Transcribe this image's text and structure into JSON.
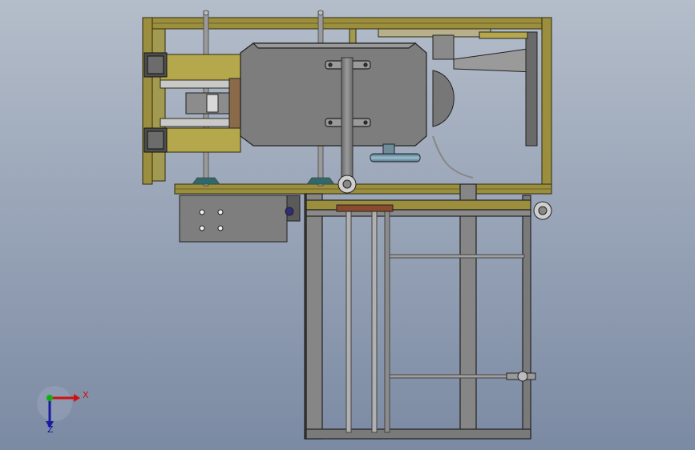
{
  "colors": {
    "background_top": "#b3bcc9",
    "background_bottom": "#7c8ba4",
    "frame_yellow": "#9b8f3e",
    "frame_edge": "#2e2a10",
    "metal_grey": "#878787",
    "metal_dark": "#5c5c5c",
    "motor_grey": "#707070",
    "panel_grey": "#828282",
    "cylinder_blue": "#6d8d9e",
    "brown_part": "#8b6a4a",
    "axis_x_red": "#d01010",
    "axis_y_blue": "#1a1aa0",
    "triad_green": "#10b010"
  },
  "triad": {
    "x_label": "X",
    "y_label": "Z"
  }
}
